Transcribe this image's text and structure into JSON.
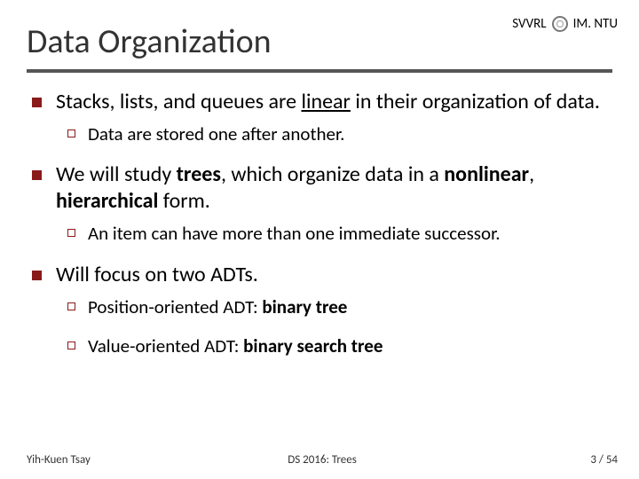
{
  "header": {
    "org_left": "SVVRL",
    "at": "@",
    "org_right": "IM. NTU"
  },
  "title": "Data Organization",
  "bullets": [
    {
      "segments": [
        {
          "t": "Stacks, lists, and queues are "
        },
        {
          "t": "linear",
          "u": true
        },
        {
          "t": " in their organization of data."
        }
      ],
      "sub": [
        {
          "segments": [
            {
              "t": "Data are stored one after another."
            }
          ]
        }
      ]
    },
    {
      "segments": [
        {
          "t": "We will study "
        },
        {
          "t": "trees",
          "b": true
        },
        {
          "t": ", which organize data in a "
        },
        {
          "t": "nonlinear",
          "b": true
        },
        {
          "t": ", "
        },
        {
          "t": "hierarchical",
          "b": true
        },
        {
          "t": " form."
        }
      ],
      "sub": [
        {
          "segments": [
            {
              "t": "An item can have more than one immediate successor."
            }
          ]
        }
      ]
    },
    {
      "segments": [
        {
          "t": "Will focus on two ADTs."
        }
      ],
      "sub": [
        {
          "segments": [
            {
              "t": "Position-oriented ADT: "
            },
            {
              "t": "binary tree",
              "b": true
            }
          ]
        },
        {
          "segments": [
            {
              "t": "Value-oriented ADT: "
            },
            {
              "t": "binary search tree",
              "b": true
            }
          ]
        }
      ]
    }
  ],
  "footer": {
    "author": "Yih-Kuen Tsay",
    "course": "DS 2016: Trees",
    "page": "3 / 54"
  }
}
